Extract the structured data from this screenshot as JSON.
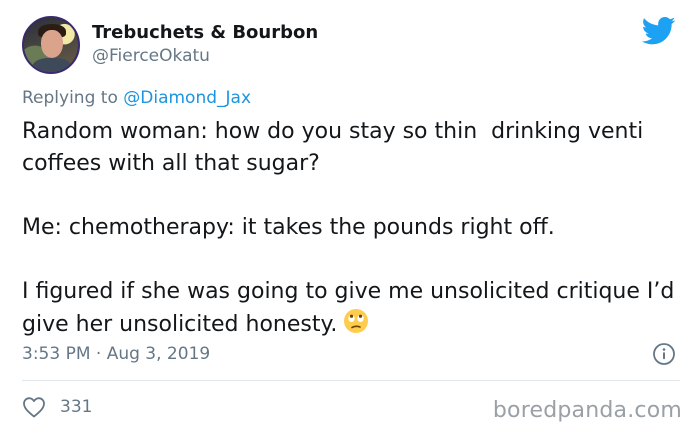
{
  "author": {
    "display_name": "Trebuchets & Bourbon",
    "handle": "@FierceOkatu"
  },
  "reply": {
    "prefix": "Replying to ",
    "mention": "@Diamond_Jax"
  },
  "tweet": {
    "line1": "Random woman: how do you stay so thin  drinking venti coffees with all that sugar?",
    "line2": "Me: chemotherapy: it takes the pounds right off.",
    "line3": "I figured if she was going to give me unsolicited critique I’d give her unsolicited honesty."
  },
  "meta": {
    "timestamp": "3:53 PM · Aug 3, 2019"
  },
  "engagement": {
    "likes": "331"
  },
  "watermark": "boredpanda.com",
  "icons": {
    "brand": "twitter-bird-icon",
    "info": "info-icon",
    "like": "heart-icon",
    "emoji": "face-with-rolling-eyes-emoji"
  },
  "colors": {
    "twitter_blue": "#1da1f2",
    "mention": "#1b95e0",
    "muted": "#657786",
    "text": "#14171a"
  }
}
